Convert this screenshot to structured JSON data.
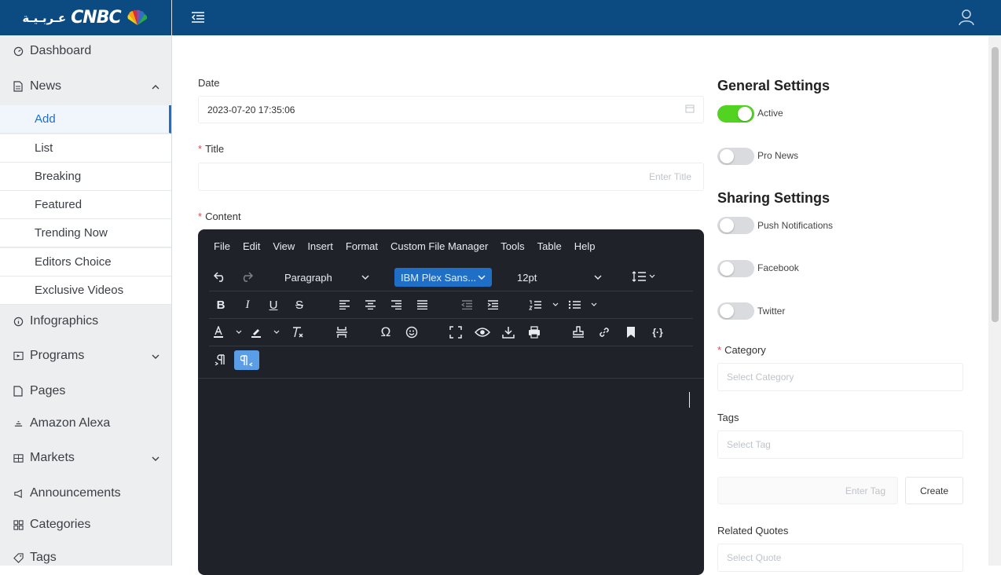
{
  "brand": {
    "arabic": "عـربـيـة",
    "name": "CNBC"
  },
  "sidebar": {
    "items": [
      {
        "label": "Dashboard",
        "icon": "gauge-icon"
      },
      {
        "label": "News",
        "icon": "document-icon"
      },
      {
        "label": "Infographics",
        "icon": "info-icon"
      },
      {
        "label": "Programs",
        "icon": "video-icon"
      },
      {
        "label": "Pages",
        "icon": "page-icon"
      },
      {
        "label": "Amazon Alexa",
        "icon": "alexa-icon"
      },
      {
        "label": "Markets",
        "icon": "grid-icon"
      },
      {
        "label": "Announcements",
        "icon": "megaphone-icon"
      },
      {
        "label": "Categories",
        "icon": "categories-icon"
      },
      {
        "label": "Tags",
        "icon": "tag-icon"
      }
    ],
    "news_sub": [
      "Add",
      "List",
      "Breaking",
      "Featured",
      "Trending Now",
      "Editors Choice",
      "Exclusive Videos"
    ],
    "active_sub": "Add"
  },
  "form": {
    "date_label": "Date",
    "date_value": "2023-07-20 17:35:06",
    "title_label": "Title",
    "title_placeholder": "Enter Title",
    "content_label": "Content"
  },
  "editor": {
    "menu": [
      "File",
      "Edit",
      "View",
      "Insert",
      "Format",
      "Custom File Manager",
      "Tools",
      "Table",
      "Help"
    ],
    "block_format": "Paragraph",
    "font_family": "IBM Plex Sans...",
    "font_size": "12pt"
  },
  "settings": {
    "general_title": "General Settings",
    "active_label": "Active",
    "active_on": true,
    "pro_news_label": "Pro News",
    "pro_news_on": false,
    "sharing_title": "Sharing Settings",
    "push_label": "Push Notifications",
    "push_on": false,
    "facebook_label": "Facebook",
    "facebook_on": false,
    "twitter_label": "Twitter",
    "twitter_on": false,
    "category_label": "Category",
    "category_placeholder": "Select Category",
    "tags_label": "Tags",
    "tags_placeholder": "Select Tag",
    "enter_tag_placeholder": "Enter Tag",
    "create_label": "Create",
    "related_quotes_label": "Related Quotes",
    "quote_placeholder": "Select Quote"
  },
  "colors": {
    "header": "#0b4b82",
    "accent": "#1f6fc6",
    "toggle_on": "#52d322",
    "editor_bg": "#1f2329"
  }
}
